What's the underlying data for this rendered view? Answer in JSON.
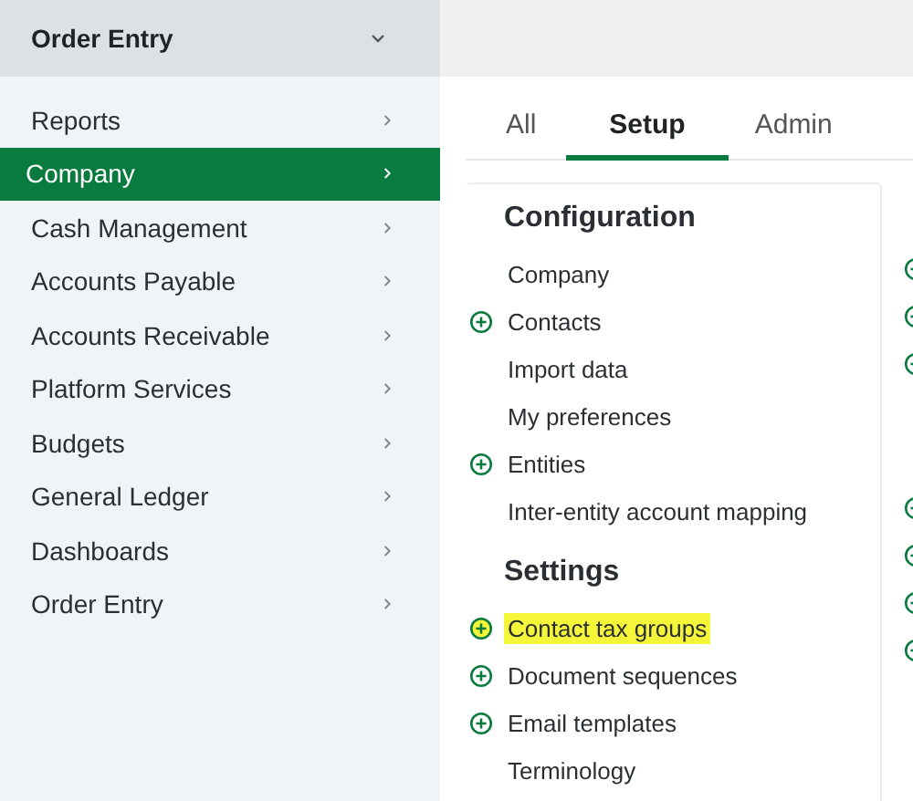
{
  "menu_header": {
    "label": "Order Entry",
    "expanded": true
  },
  "sidebar": {
    "items": [
      {
        "label": "Reports",
        "selected": false
      },
      {
        "label": "Company",
        "selected": true
      },
      {
        "label": "Cash Management",
        "selected": false
      },
      {
        "label": "Accounts Payable",
        "selected": false
      },
      {
        "label": "Accounts Receivable",
        "selected": false
      },
      {
        "label": "Platform Services",
        "selected": false
      },
      {
        "label": "Budgets",
        "selected": false
      },
      {
        "label": "General Ledger",
        "selected": false
      },
      {
        "label": "Dashboards",
        "selected": false
      },
      {
        "label": "Order Entry",
        "selected": false
      }
    ]
  },
  "tabs": [
    {
      "label": "All",
      "selected": false
    },
    {
      "label": "Setup",
      "selected": true
    },
    {
      "label": "Admin",
      "selected": false
    }
  ],
  "sections": [
    {
      "title": "Configuration",
      "items": [
        {
          "label": "Company",
          "add": false,
          "highlighted": false
        },
        {
          "label": "Contacts",
          "add": true,
          "highlighted": false
        },
        {
          "label": "Import data",
          "add": false,
          "highlighted": false
        },
        {
          "label": "My preferences",
          "add": false,
          "highlighted": false
        },
        {
          "label": "Entities",
          "add": true,
          "highlighted": false
        },
        {
          "label": "Inter-entity account mapping",
          "add": false,
          "highlighted": false
        }
      ]
    },
    {
      "title": "Settings",
      "items": [
        {
          "label": "Contact tax groups",
          "add": true,
          "highlighted": true
        },
        {
          "label": "Document sequences",
          "add": true,
          "highlighted": false
        },
        {
          "label": "Email templates",
          "add": true,
          "highlighted": false
        },
        {
          "label": "Terminology",
          "add": false,
          "highlighted": false
        }
      ]
    }
  ]
}
